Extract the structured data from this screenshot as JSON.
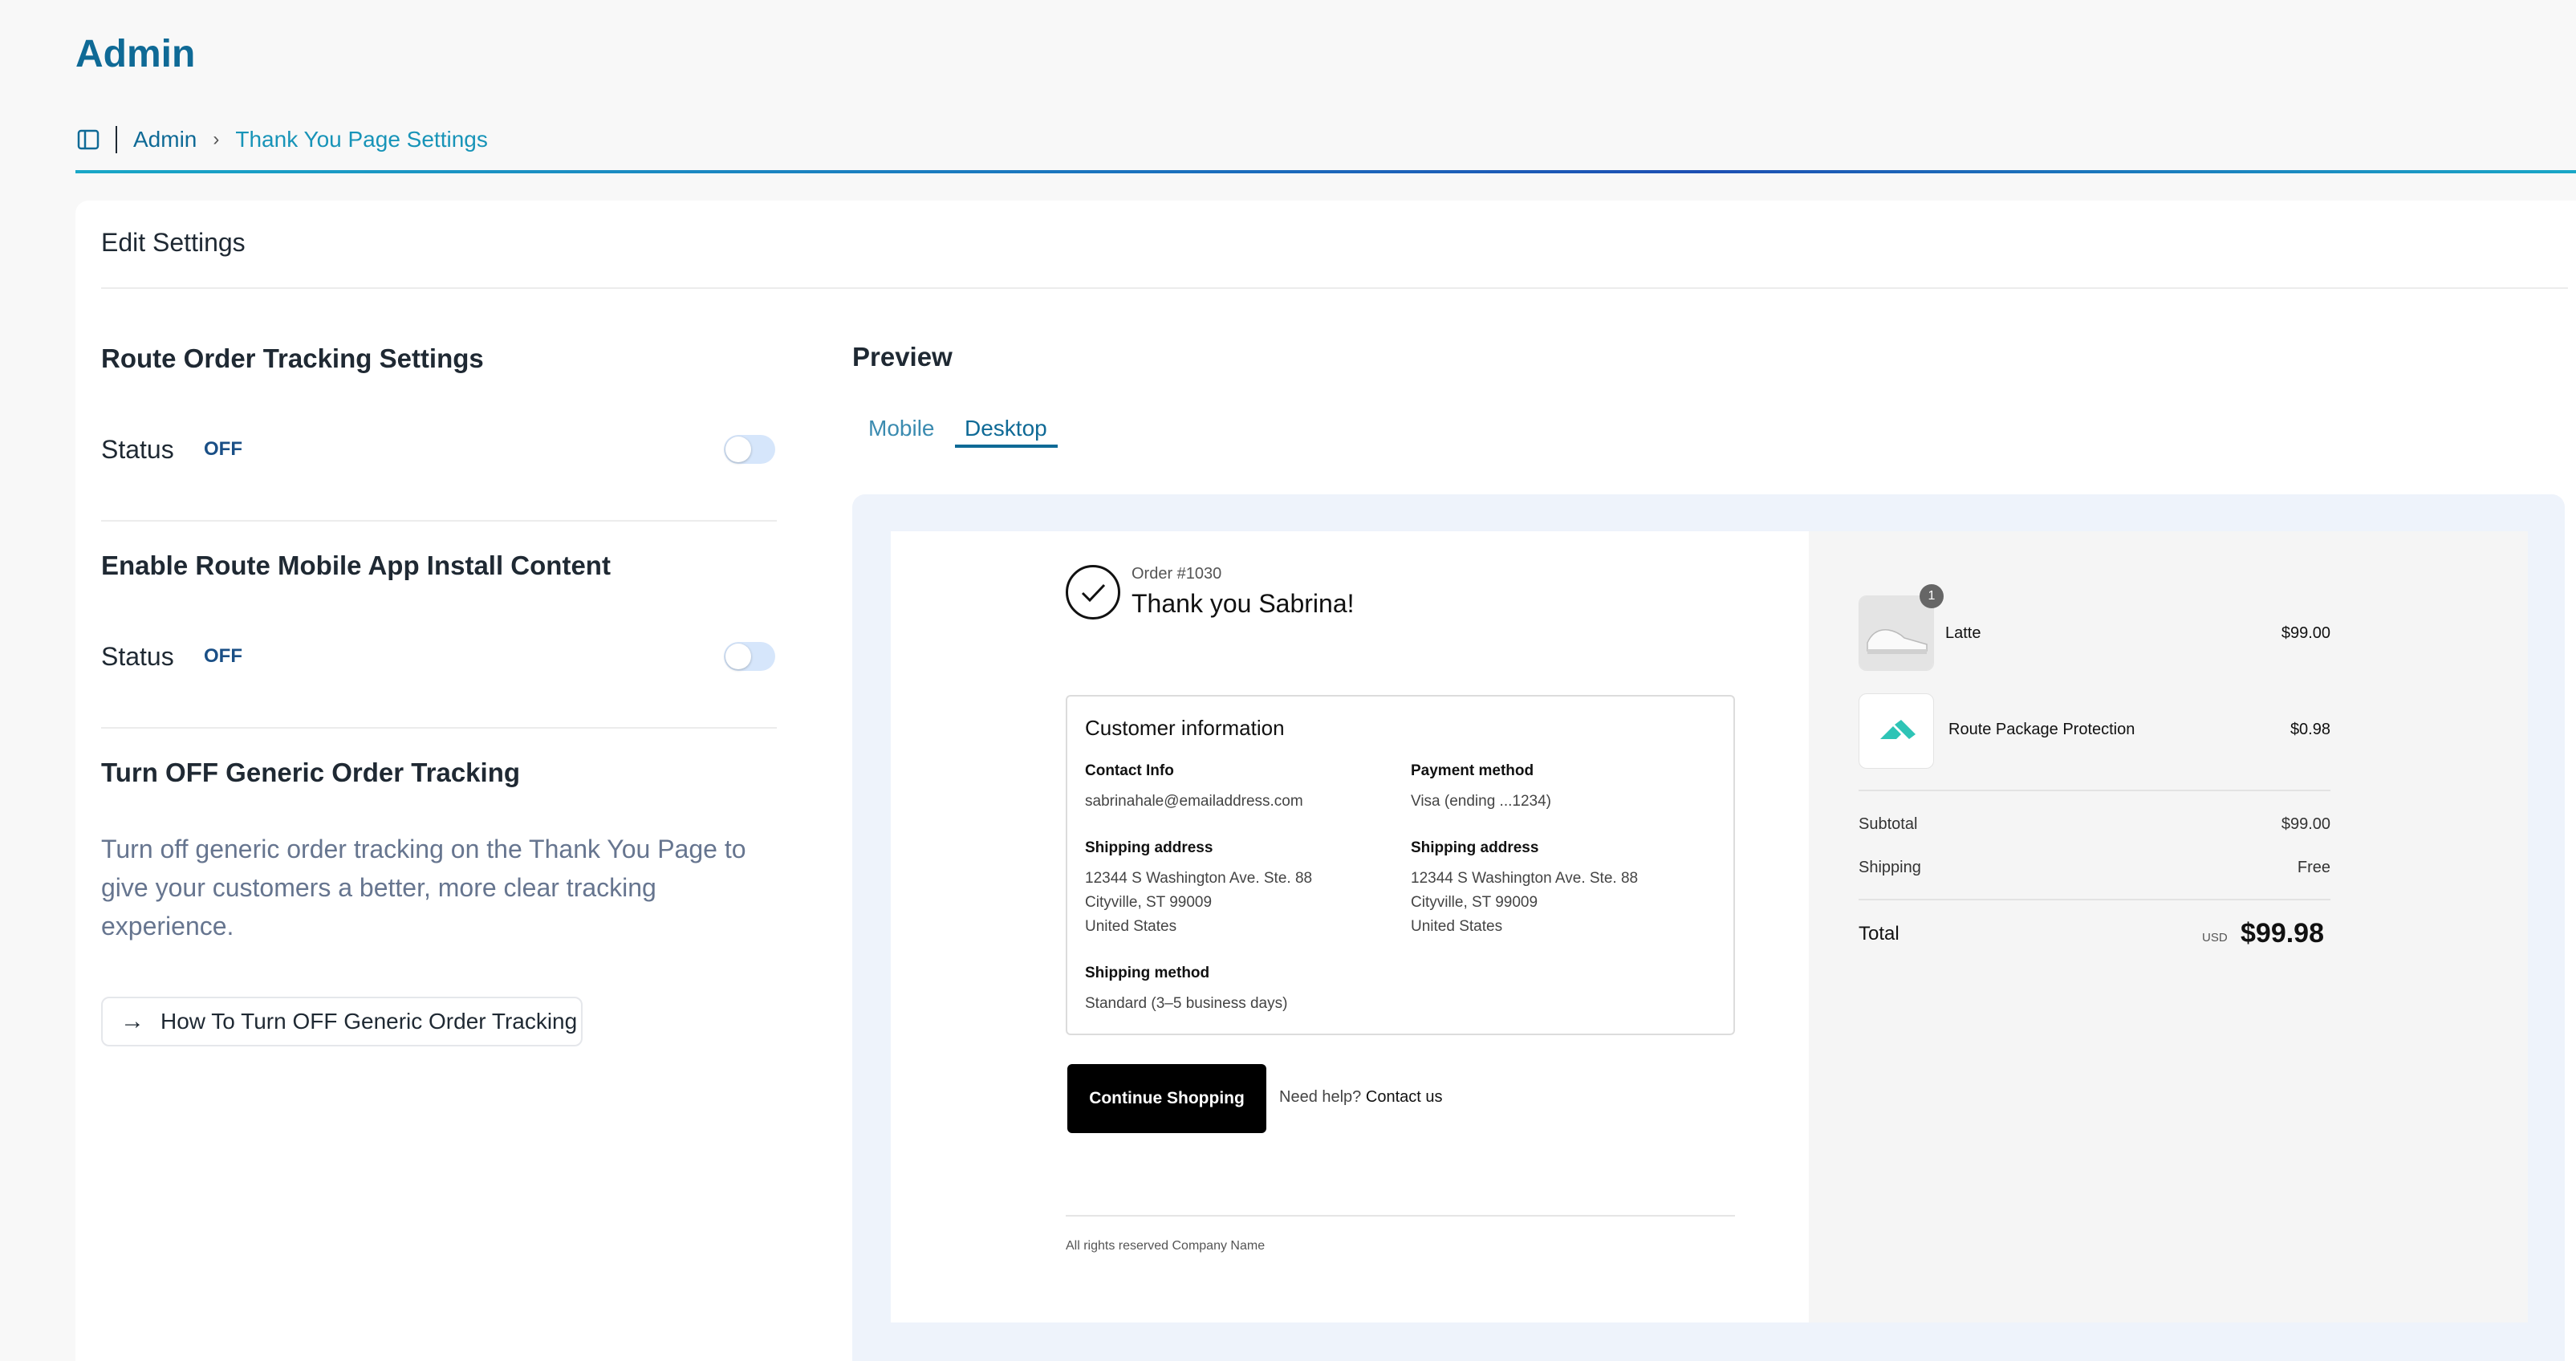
{
  "page_title": "Admin",
  "breadcrumb": {
    "root": "Admin",
    "current": "Thank You Page Settings"
  },
  "card_title": "Edit Settings",
  "settings": {
    "route_tracking": {
      "heading": "Route Order Tracking Settings",
      "status_label": "Status",
      "status_value": "OFF",
      "enabled": false
    },
    "mobile_app": {
      "heading": "Enable Route Mobile App Install Content",
      "status_label": "Status",
      "status_value": "OFF",
      "enabled": false
    },
    "generic": {
      "heading": "Turn OFF Generic Order Tracking",
      "description": "Turn off generic order tracking on the Thank You Page to give your customers a better, more clear tracking experience.",
      "button_label": "How To Turn OFF Generic Order Tracking"
    }
  },
  "preview": {
    "heading": "Preview",
    "tabs": [
      {
        "label": "Mobile",
        "active": false
      },
      {
        "label": "Desktop",
        "active": true
      }
    ],
    "order_number": "Order #1030",
    "thank_you": "Thank you Sabrina!",
    "customer_info": {
      "title": "Customer information",
      "contact_label": "Contact Info",
      "contact_value": "sabrinahale@emailaddress.com",
      "payment_label": "Payment method",
      "payment_value": "Visa (ending ...1234)",
      "shipping_address_label": "Shipping address",
      "shipping_address_lines": [
        "12344 S Washington Ave. Ste. 88",
        "Cityville, ST 99009",
        "United States"
      ],
      "billing_address_label": "Shipping address",
      "billing_address_lines": [
        "12344 S Washington Ave. Ste. 88",
        "Cityville, ST 99009",
        "United States"
      ],
      "shipping_method_label": "Shipping method",
      "shipping_method_value": "Standard (3–5 business days)"
    },
    "continue_label": "Continue Shopping",
    "help_text": "Need help?",
    "contact_link": "Contact us",
    "footer_text": "All rights reserved Company Name",
    "order_summary": {
      "items": [
        {
          "name": "Latte",
          "price": "$99.00",
          "quantity": "1",
          "icon": "sneaker-image"
        },
        {
          "name": "Route Package Protection",
          "price": "$0.98",
          "icon": "route-logo-icon"
        }
      ],
      "subtotal_label": "Subtotal",
      "subtotal_value": "$99.00",
      "shipping_label": "Shipping",
      "shipping_value": "Free",
      "total_label": "Total",
      "total_currency": "USD",
      "total_value": "$99.98"
    }
  },
  "colors": {
    "brand": "#0f6a96",
    "accent": "#19a7c7",
    "toggle_off": "#d6e6fb"
  }
}
